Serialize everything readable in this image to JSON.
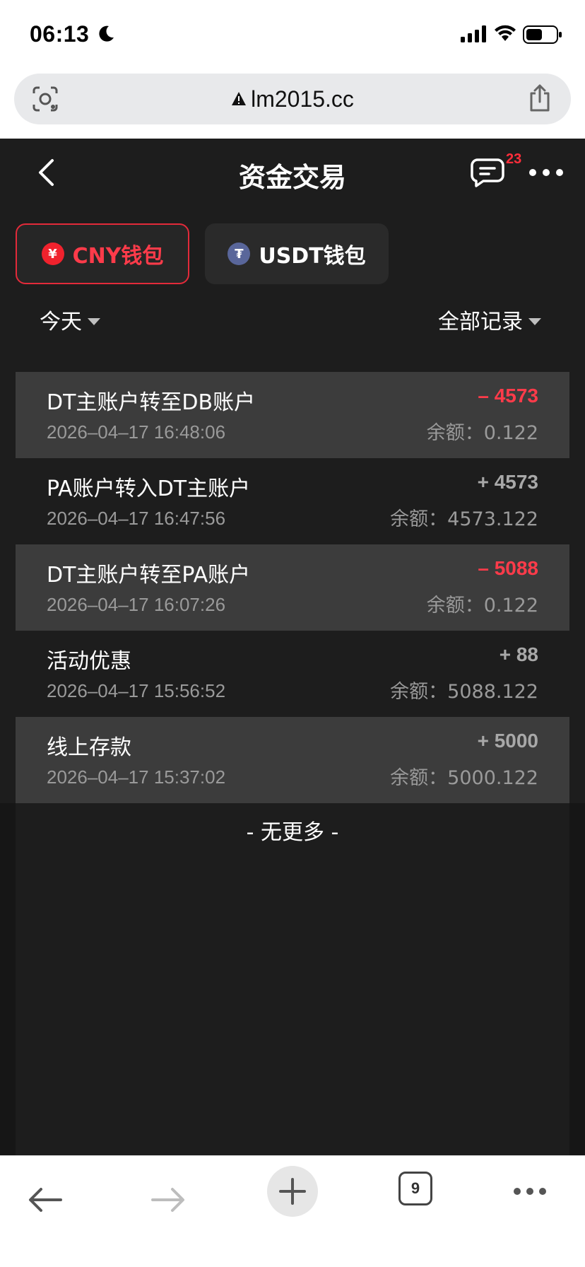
{
  "status": {
    "time": "06:13"
  },
  "browser": {
    "url": "lm2015.cc"
  },
  "header": {
    "title": "资金交易",
    "badge": "23"
  },
  "tabs": [
    {
      "label": "CNY钱包",
      "coin": "¥",
      "active": true
    },
    {
      "label": "USDT钱包",
      "coin": "₮",
      "active": false
    }
  ],
  "filters": {
    "date": "今天",
    "type": "全部记录"
  },
  "records": [
    {
      "title": "DT主账户转至DB账户",
      "time": "2026–04–17 16:48:06",
      "amount": "– 4573",
      "balance": "余额：0.122",
      "sign": "neg"
    },
    {
      "title": "PA账户转入DT主账户",
      "time": "2026–04–17 16:47:56",
      "amount": "+ 4573",
      "balance": "余额：4573.122",
      "sign": "pos"
    },
    {
      "title": "DT主账户转至PA账户",
      "time": "2026–04–17 16:07:26",
      "amount": "– 5088",
      "balance": "余额：0.122",
      "sign": "neg"
    },
    {
      "title": "活动优惠",
      "time": "2026–04–17 15:56:52",
      "amount": "+ 88",
      "balance": "余额：5088.122",
      "sign": "pos"
    },
    {
      "title": "线上存款",
      "time": "2026–04–17 15:37:02",
      "amount": "+ 5000",
      "balance": "余额：5000.122",
      "sign": "pos"
    }
  ],
  "footer": {
    "no_more": "- 无更多 -"
  },
  "toolbar": {
    "tab_count": "9"
  },
  "colors": {
    "accent_red": "#ff3b4a",
    "shade_row": "#3c3c3c",
    "background": "#1d1d1d"
  }
}
